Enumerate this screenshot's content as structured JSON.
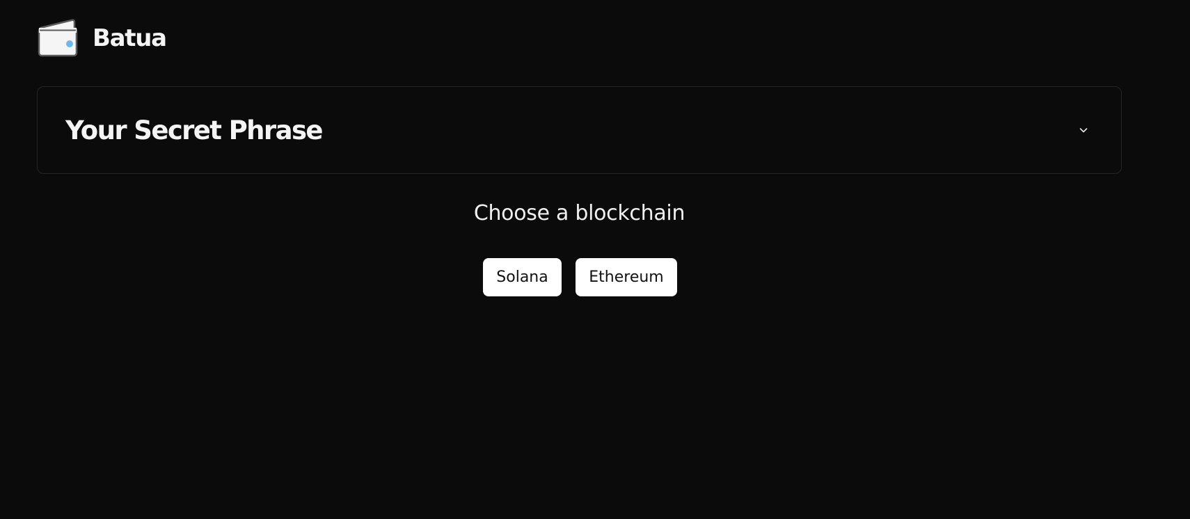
{
  "header": {
    "app_name": "Batua",
    "logo_icon": "wallet-icon",
    "logo_accent_color": "#6cb9ee"
  },
  "secret_phrase": {
    "title": "Your Secret Phrase",
    "toggle_icon": "chevron-down-icon",
    "expanded": false
  },
  "blockchain": {
    "heading": "Choose a blockchain",
    "options": [
      {
        "label": "Solana"
      },
      {
        "label": "Ethereum"
      }
    ]
  },
  "theme": {
    "background": "#0b0b0b",
    "button_background": "#ffffff",
    "button_text": "#111111"
  }
}
